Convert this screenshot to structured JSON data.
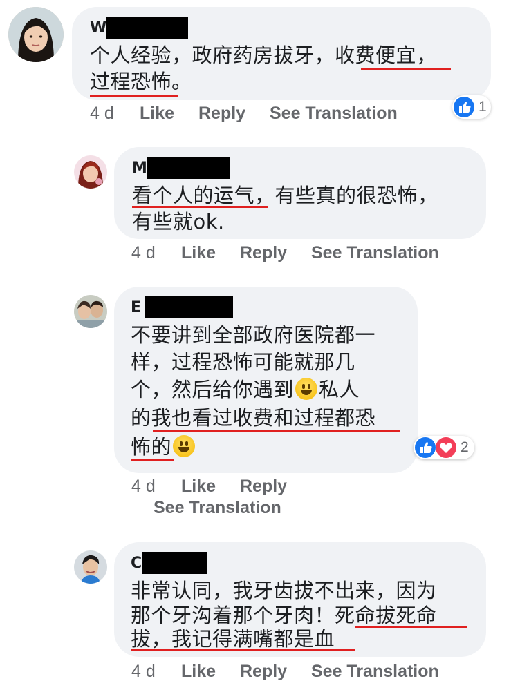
{
  "comments": [
    {
      "author_initial": "W",
      "lines": [
        "个人经验，政府药房拔牙，收费便宜，",
        "过程恐怖。"
      ],
      "time": "4 d",
      "like": "Like",
      "reply": "Reply",
      "see_translation": "See Translation",
      "reaction_count": "1"
    },
    {
      "author_initial": "M",
      "lines": [
        "看个人的运气，有些真的很恐怖，",
        "有些就ok."
      ],
      "time": "4 d",
      "like": "Like",
      "reply": "Reply",
      "see_translation": "See Translation"
    },
    {
      "author_initial": "E",
      "lines": [
        "不要讲到全部政府医院都一",
        "样，过程恐怖可能就那几",
        "个，然后给你遇到",
        "私人",
        "的我也看过收费和过程都恐",
        "怖的"
      ],
      "time": "4 d",
      "like": "Like",
      "reply": "Reply",
      "see_translation": "See Translation",
      "reaction_count": "2"
    },
    {
      "author_initial": "C",
      "lines": [
        "非常认同，我牙齿拔不出来，因为",
        "那个牙沟着那个牙肉！死命拔死命",
        "拔，我记得满嘴都是血"
      ],
      "time": "4 d",
      "like": "Like",
      "reply": "Reply",
      "see_translation": "See Translation"
    }
  ],
  "colors": {
    "bubble": "#f0f2f5",
    "underline": "#e02020",
    "like_blue": "#1877f2",
    "love_red": "#f33e58",
    "meta_gray": "#65676b"
  },
  "icons": {
    "like_reaction": "thumbs-up-icon",
    "love_reaction": "heart-icon",
    "emoji": "grinning-face-emoji"
  }
}
